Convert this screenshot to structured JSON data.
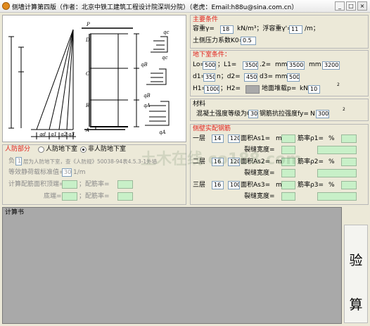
{
  "window": {
    "title": "侧墙计算第四版（作者：北京中铁工建筑工程设计院深圳分院）（老虎：Email:h88u@sina.com.cn）",
    "minimize": "_",
    "maximize": "□",
    "close": "×"
  },
  "diagram": {
    "top_load_label": "P",
    "labels": [
      "D",
      "C",
      "B",
      "A",
      "qc",
      "qc",
      "qB",
      "qB",
      "qA",
      "qA",
      "qd",
      "q1",
      "q2",
      "q3"
    ]
  },
  "main": {
    "title": "主要条件",
    "unit_weight_label": "容重γ=",
    "unit_weight_value": "18",
    "unit_weight_unit": "kN/m³；浮容重γ'=",
    "float_value": "11",
    "float_unit": "/m；",
    "k0_label": "土侧压力系数K0=",
    "k0_value": "0.5"
  },
  "basement": {
    "title": "地下室条件：",
    "lo_label": "Lo=",
    "lo_value": "500",
    "l1_label": "；L1=",
    "l1_value": "3500",
    "l2_label": ".2=",
    "mm1": "mm",
    "l2_value": "3500",
    "mm2": "mm",
    "l3_value": "3200",
    "d1_label": "d1=",
    "d1_value": "350",
    "d2_label": "n；d2=",
    "d2_value": "450",
    "d3_label": "d3=",
    "mm3": "mm",
    "d3_value": "500",
    "h1_label": "H1=",
    "h1_value": "1000",
    "h2_label": "；H2=",
    "surcharge_label": "地面堆载p=",
    "surcharge_unit": "kN",
    "surcharge_value": "10"
  },
  "material": {
    "title": "材料",
    "text": "混凝土强度等级为C",
    "concrete": "30",
    "steel_label": "钢筋抗拉强度fy=",
    "steel_unit": "N",
    "steel_value": "300"
  },
  "civil": {
    "title": "人防部分",
    "opt1": "人防地下室",
    "opt2": "非人防地下室",
    "line1_pre": "负",
    "line1_value": "1",
    "line1_text": "层为人防地下室，查《人防规》50038-94表4.5.3-1外墙",
    "line2_label": "等效静荷载标准值=",
    "line2_value": "30",
    "line2_unit": "1/m",
    "line3_label": "计算配筋面积顶端=",
    "ratio1_label": "；配筋率=",
    "line4_label": "底端=",
    "ratio2_label": "；配筋率="
  },
  "reinf": {
    "title": "侧壁实配钢筋",
    "rows": [
      {
        "floor": "一层",
        "d": "14",
        "s": "120",
        "area_label": "面积As1=",
        "m": "m",
        "ratio_label": "筋率ρ1=",
        "pct": "%",
        "crack_label": "裂缝宽度="
      },
      {
        "floor": "二层",
        "d": "16",
        "s": "120",
        "area_label": "面积As2=",
        "m": "m",
        "ratio_label": "筋率ρ2=",
        "pct": "%",
        "crack_label": "裂缝宽度="
      },
      {
        "floor": "三层",
        "d": "16",
        "s": "100",
        "area_label": "面积As3=",
        "m": "m",
        "ratio_label": "筋率ρ3=",
        "pct": "%",
        "crack_label": "裂缝宽度="
      }
    ]
  },
  "report": {
    "title": "计算书"
  },
  "verify_button": {
    "char1": "验",
    "char2": "算"
  },
  "watermark": "土木在线 co188.com"
}
